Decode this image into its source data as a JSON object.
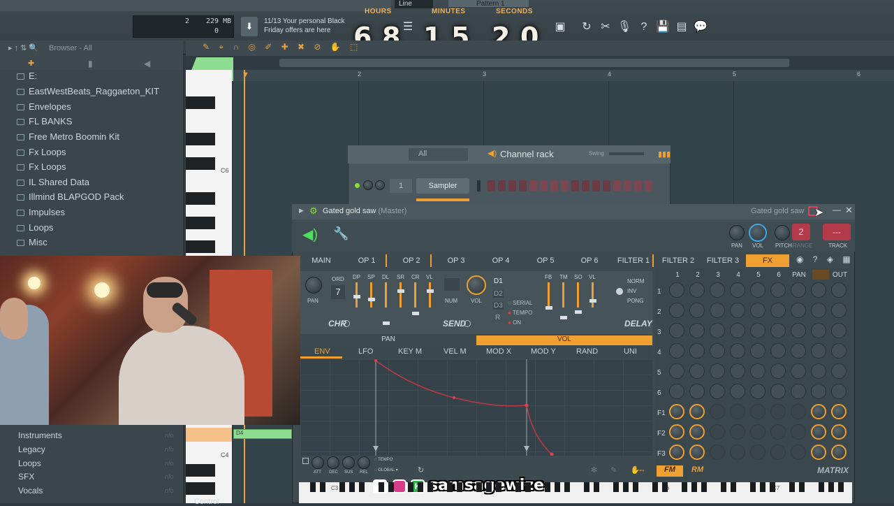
{
  "toolbar": {
    "cpu_value": "2",
    "memory": "229 MB",
    "poly": "0",
    "news_date": "11/13",
    "news_line1": "Your personal Black",
    "news_line2": "Friday offers are here",
    "snap_mode": "Line",
    "pattern": "Pattern 1"
  },
  "countdown": {
    "hours_label": "HOURS",
    "minutes_label": "MINUTES",
    "seconds_label": "SECONDS",
    "hours": [
      "6",
      "8"
    ],
    "minutes": [
      "1",
      "5"
    ],
    "seconds": [
      "2",
      "0"
    ]
  },
  "browser": {
    "title": "Browser - All",
    "items": [
      "E:",
      "EastWestBeats_Raggaeton_KIT",
      "Envelopes",
      "FL BANKS",
      "Free Metro Boomin Kit",
      "Fx Loops",
      "Fx Loops",
      "IL Shared Data",
      "Illmind BLAPGOD Pack",
      "Impulses",
      "Loops",
      "Misc"
    ],
    "lower_items": [
      "Instruments",
      "Legacy",
      "Loops",
      "SFX",
      "Vocals"
    ],
    "info_tag": "nfo",
    "bottom_label": "Control"
  },
  "piano_roll": {
    "ruler": [
      "2",
      "3",
      "4",
      "5",
      "6"
    ],
    "key_c6": "C6",
    "key_c4": "C4",
    "note_label": "D4"
  },
  "channel_rack": {
    "title": "Channel rack",
    "filter": "All",
    "swing_label": "Swing",
    "channel_number": "1",
    "channel_name": "Sampler"
  },
  "plugin": {
    "title": "Gated gold saw",
    "title_suffix": "(Master)",
    "title_right": "Gated gold saw",
    "knob_labels": [
      "PAN",
      "VOL",
      "PITCH",
      "RANGE"
    ],
    "range_value": "2",
    "track_label": "TRACK",
    "track_value": "---",
    "tabs": [
      "MAIN",
      "OP 1",
      "OP 2",
      "OP 3",
      "OP 4",
      "OP 5",
      "OP 6",
      "FILTER 1",
      "FILTER 2",
      "FILTER 3",
      "FX"
    ],
    "active_tab": "FX",
    "chorus": {
      "label": "PAN",
      "ord_label": "ORD",
      "ord_value": "7",
      "slider_labels": [
        "DP",
        "SP",
        "DL",
        "SR",
        "CR",
        "VL"
      ],
      "name": "CHR"
    },
    "send": {
      "num": "NUM",
      "vol": "VOL",
      "name": "SEND"
    },
    "delay": {
      "modes": [
        "D1",
        "D2",
        "D3",
        "R"
      ],
      "options": [
        "SERIAL",
        "TEMPO",
        "ON"
      ],
      "slider_labels": [
        "FB",
        "TM",
        "SO",
        "VL"
      ],
      "types": [
        "NORM",
        "INV",
        "PONG"
      ],
      "name": "DELAY"
    },
    "pan_label": "PAN",
    "vol_label": "VOL",
    "env_tabs": [
      "ENV",
      "LFO",
      "KEY M",
      "VEL M",
      "MOD X",
      "MOD Y",
      "RAND",
      "UNI"
    ],
    "active_env_tab": "ENV",
    "env_knobs": [
      "ATT",
      "DEC",
      "SUS",
      "REL"
    ],
    "env_opts": [
      "TEMPO",
      "GLOBAL"
    ],
    "matrix": {
      "cols": [
        "1",
        "2",
        "3",
        "4",
        "5",
        "6",
        "PAN",
        "FX",
        "OUT"
      ],
      "rows": [
        "1",
        "2",
        "3",
        "4",
        "5",
        "6",
        "F1",
        "F2",
        "F3"
      ],
      "modes": [
        "FM",
        "RM"
      ],
      "name": "MATRIX"
    }
  },
  "keyboard_labels": [
    "C3",
    "C4",
    "C6",
    "C7"
  ],
  "social": {
    "handle": "samsagewize"
  }
}
